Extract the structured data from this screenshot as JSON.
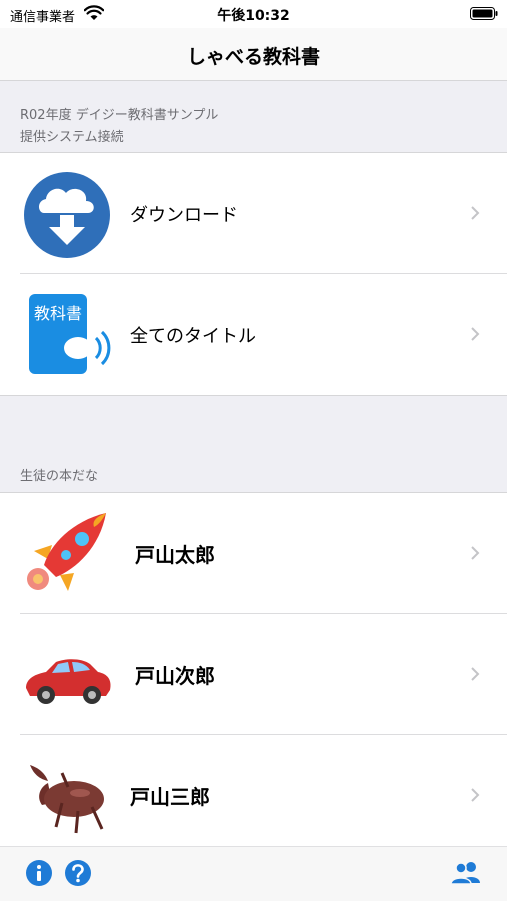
{
  "status_bar": {
    "carrier": "通信事業者",
    "time": "午後10:32"
  },
  "nav": {
    "title": "しゃべる教科書"
  },
  "section1": {
    "line1": "R02年度 デイジー教科書サンプル",
    "line2": "提供システム接続",
    "items": [
      {
        "label": "ダウンロード",
        "icon": "cloud-download-icon"
      },
      {
        "label": "全てのタイトル",
        "icon": "textbook-speaker-icon",
        "icon_text": "教科書"
      }
    ]
  },
  "section2": {
    "header": "生徒の本だな",
    "students": [
      {
        "name": "戸山太郎",
        "icon": "rocket-icon"
      },
      {
        "name": "戸山次郎",
        "icon": "red-car-icon"
      },
      {
        "name": "戸山三郎",
        "icon": "beetle-icon"
      }
    ]
  },
  "toolbar": {
    "info_icon": "info-icon",
    "help_icon": "question-icon",
    "users_icon": "users-icon"
  },
  "colors": {
    "accent": "#1f7bd6",
    "icon_blue": "#2f6fb9",
    "book_blue": "#1a8de2",
    "chevron": "#c4c4c7"
  }
}
